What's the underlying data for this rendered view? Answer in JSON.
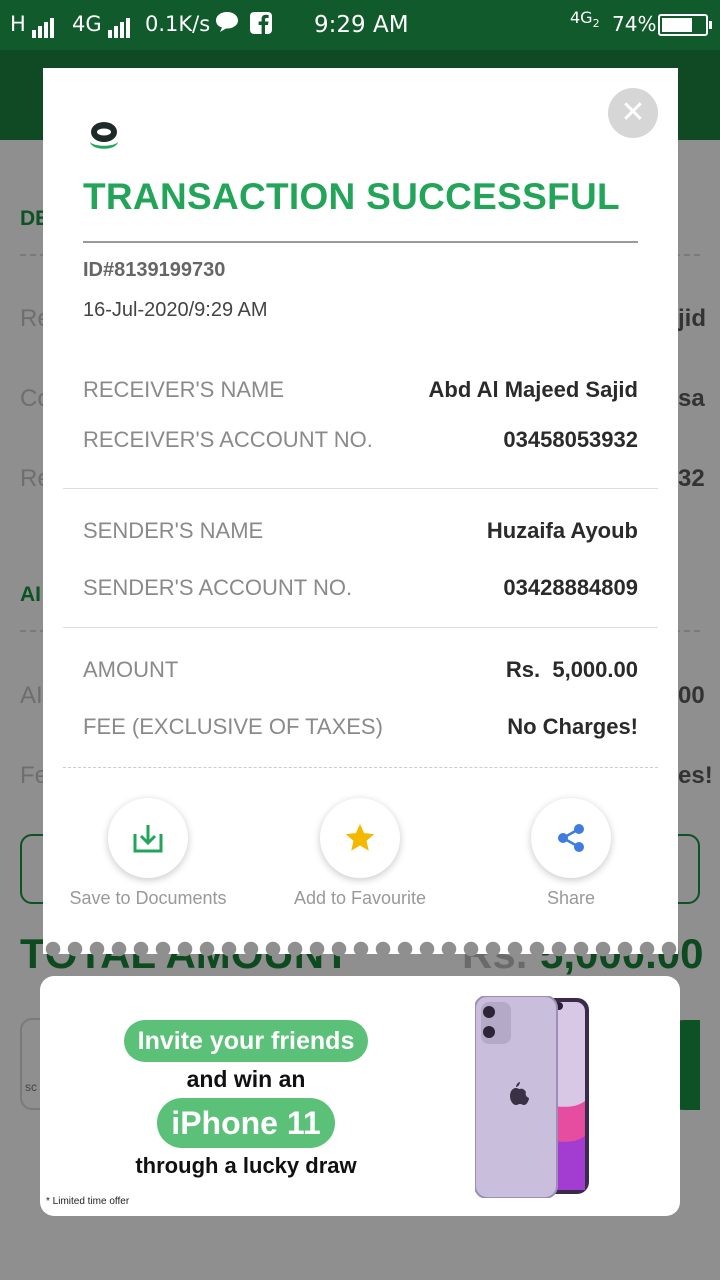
{
  "status_bar": {
    "network_left": "H",
    "network_type": "4G",
    "speed": "0.1K/s",
    "time": "9:29 AM",
    "network_right": "4G",
    "sim": "2",
    "battery": "74%"
  },
  "background": {
    "section1_heading": "DE",
    "row1_label": "Re",
    "row1_value": "jid",
    "row2_label": "Co",
    "row2_value": "sa",
    "row3_label": "Re",
    "row3_value": "32",
    "section2_heading": "AI",
    "row4_label": "AI",
    "row4_value": "00",
    "row5_label": "Fe",
    "row5_value": "es!",
    "total_label": "TOTAL AMOUNT",
    "total_currency": "Rs.",
    "total_value": "5,000.00",
    "bottom_left": "sc"
  },
  "receipt": {
    "title": "TRANSACTION SUCCESSFUL",
    "id": "ID#8139199730",
    "datetime": "16-Jul-2020/9:29 AM",
    "receiver_name_label": "RECEIVER'S NAME",
    "receiver_name": "Abd Al Majeed Sajid",
    "receiver_account_label": "RECEIVER'S ACCOUNT NO.",
    "receiver_account": "03458053932",
    "sender_name_label": "SENDER'S NAME",
    "sender_name": "Huzaifa Ayoub",
    "sender_account_label": "SENDER'S ACCOUNT NO.",
    "sender_account": "03428884809",
    "amount_label": "AMOUNT",
    "amount": "Rs.  5,000.00",
    "fee_label": "FEE (EXCLUSIVE OF TAXES)",
    "fee": "No Charges!"
  },
  "actions": {
    "save": "Save to Documents",
    "favourite": "Add to Favourite",
    "share": "Share"
  },
  "ad": {
    "line1": "Invite your friends",
    "line2": "and win an",
    "line3": "iPhone 11",
    "line4": "through a lucky draw",
    "note": "* Limited time offer"
  },
  "colors": {
    "brand_green": "#22a559",
    "header_green": "#115a2c",
    "star": "#f5b800",
    "share_blue": "#3f7be0"
  },
  "icons": [
    "close-icon",
    "logo-icon",
    "download-icon",
    "star-icon",
    "share-icon",
    "chat-icon",
    "facebook-icon",
    "battery-icon"
  ]
}
